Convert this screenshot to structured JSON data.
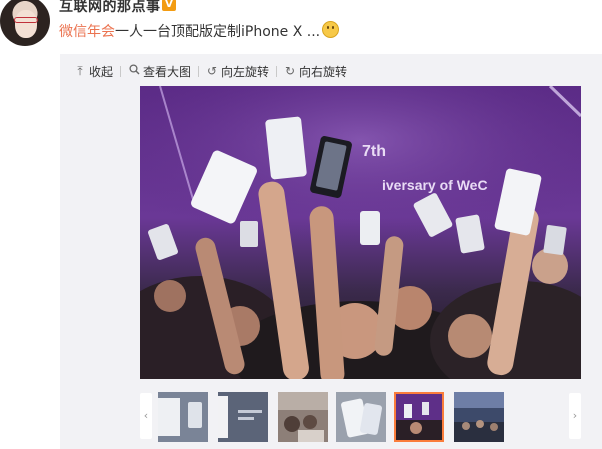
{
  "user": {
    "name": "互联网的那点事",
    "verified_badge": "V"
  },
  "post": {
    "topic": "微信年会",
    "text": "一人一台顶配版定制iPhone X ...",
    "emoji": "smile-emoji"
  },
  "toolbar": {
    "collapse": "收起",
    "view_large": "查看大图",
    "rotate_left": "向左旋转",
    "rotate_right": "向右旋转",
    "icons": {
      "collapse": "arrow-up-icon",
      "view_large": "magnifier-icon",
      "rotate_left": "rotate-left-icon",
      "rotate_right": "rotate-right-icon"
    }
  },
  "photo": {
    "banner_text_1": "7th",
    "banner_text_2": "iversary of WeC"
  },
  "thumbnails": {
    "count": 6,
    "active_index": 4,
    "prev_arrow": "‹",
    "next_arrow": "›"
  },
  "colors": {
    "topic_link": "#eb7350",
    "active_thumb_border": "#fa7d3c",
    "badge": "#f39c12",
    "media_background": "#f2f2f5"
  }
}
